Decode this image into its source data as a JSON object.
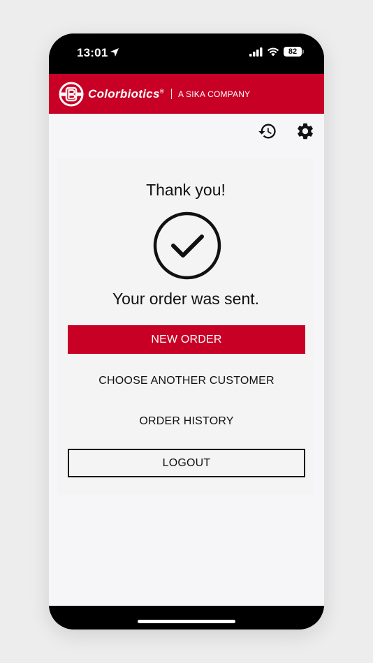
{
  "status_bar": {
    "time": "13:01",
    "battery": "82"
  },
  "brand": {
    "name": "Colorbiotics",
    "registered": "®",
    "tagline": "A SIKA COMPANY",
    "color": "#c80025"
  },
  "toolbar": {
    "history_icon": "history-icon",
    "settings_icon": "gear-icon"
  },
  "confirmation": {
    "title": "Thank you!",
    "message": "Your order was sent.",
    "icon": "check-circle-icon"
  },
  "actions": {
    "new_order": "NEW ORDER",
    "choose_customer": "CHOOSE ANOTHER CUSTOMER",
    "order_history": "ORDER HISTORY",
    "logout": "LOGOUT"
  }
}
